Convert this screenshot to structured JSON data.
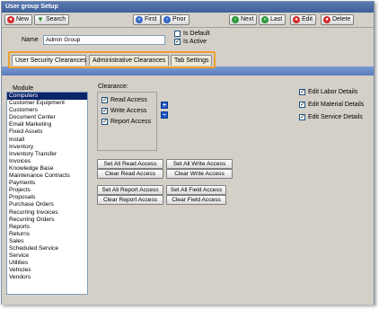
{
  "window": {
    "title": "User group Setup"
  },
  "toolbar": {
    "new": "New",
    "search": "Search",
    "first": "First",
    "prior": "Prior",
    "next": "Next",
    "last": "Last",
    "edit": "Edit",
    "delete": "Delete"
  },
  "header": {
    "name_label": "Name",
    "name_value": "Admin Group",
    "is_default_label": "Is Default",
    "is_default_checked": false,
    "is_active_label": "Is Active",
    "is_active_checked": true
  },
  "tabs": [
    {
      "label": "User Security Clearances",
      "active": true
    },
    {
      "label": "Administrative Clearances",
      "active": false
    },
    {
      "label": "Tab Settings",
      "active": false
    }
  ],
  "module": {
    "label": "Module",
    "selected": "Computers",
    "items": [
      "Computers",
      "Customer Equipment",
      "Customers",
      "Document Center",
      "Email Marketing",
      "Fixed Assets",
      "Install",
      "Inventory",
      "Inventory Transfer",
      "Invoices",
      "Knowledge Base",
      "Maintenance Contracts",
      "Payments",
      "Projects",
      "Proposals",
      "Purchase Orders",
      "Recurring Invoices",
      "Recurring Orders",
      "Reports",
      "Returns",
      "Sales",
      "Scheduled Service",
      "Service",
      "Utilities",
      "Vehicles",
      "Vendors"
    ]
  },
  "clearance": {
    "label": "Clearance:",
    "read": {
      "label": "Read Access",
      "checked": true
    },
    "write": {
      "label": "Write Access",
      "checked": true
    },
    "report": {
      "label": "Report Access",
      "checked": true
    }
  },
  "edit_details": {
    "labor": {
      "label": "Edit Labor Details",
      "checked": true
    },
    "material": {
      "label": "Edit Material Details",
      "checked": true
    },
    "service": {
      "label": "Edit Service Details",
      "checked": true
    }
  },
  "actions": {
    "set_all_read": "Set All Read Access",
    "set_all_write": "Set All Write Access",
    "clear_read": "Clear Read Access",
    "clear_write": "Clear Write Access",
    "set_all_report": "Set All Report Access",
    "set_all_field": "Set All Field Access",
    "clear_report": "Clear Report Access",
    "clear_field": "Clear Field Access"
  },
  "colors": {
    "tab_highlight": "#f0a030",
    "selected_row": "#0a246a",
    "tab_strip": "#5a7bbd"
  }
}
